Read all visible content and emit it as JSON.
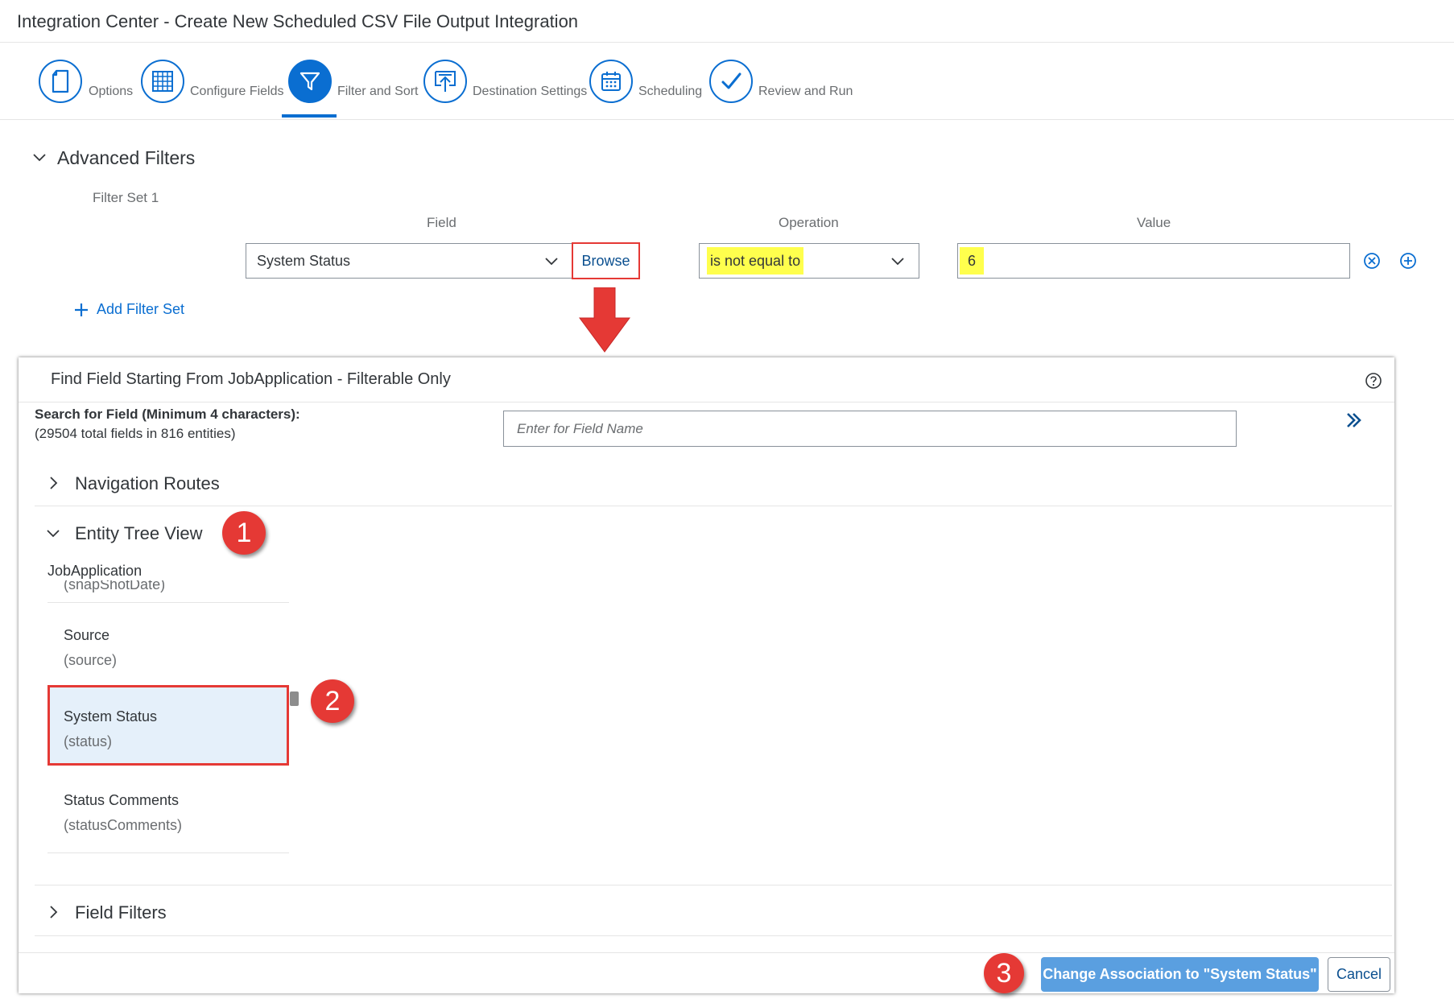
{
  "header": {
    "title": "Integration Center - Create New Scheduled CSV File Output Integration"
  },
  "wizard": {
    "steps": [
      {
        "label": "Options",
        "icon": "document-icon",
        "active": false
      },
      {
        "label": "Configure Fields",
        "icon": "table-grid-icon",
        "active": false
      },
      {
        "label": "Filter and Sort",
        "icon": "filter-icon",
        "active": true
      },
      {
        "label": "Destination Settings",
        "icon": "upload-icon",
        "active": false
      },
      {
        "label": "Scheduling",
        "icon": "calendar-icon",
        "active": false
      },
      {
        "label": "Review and Run",
        "icon": "checkmark-icon",
        "active": false
      }
    ]
  },
  "advanced_filters": {
    "title": "Advanced Filters",
    "filter_set_label": "Filter Set 1",
    "columns": {
      "field": "Field",
      "operation": "Operation",
      "value": "Value"
    },
    "row": {
      "field_value": "System Status",
      "browse_label": "Browse",
      "operation_value": "is not equal to",
      "value": "6"
    },
    "add_filter_set_label": "Add Filter Set"
  },
  "dialog": {
    "title": "Find Field Starting From JobApplication - Filterable Only",
    "search_label": "Search for Field (Minimum 4 characters):",
    "search_stats": "(29504 total fields in 816 entities)",
    "search_placeholder": "Enter for Field Name",
    "sections": {
      "navigation_routes": "Navigation Routes",
      "entity_tree_view": "Entity Tree View",
      "field_filters": "Field Filters"
    },
    "tree_root": "JobApplication",
    "tree_items": [
      {
        "name": "",
        "id": "(snapShotDate)"
      },
      {
        "name": "Source",
        "id": "(source)"
      },
      {
        "name": "System Status",
        "id": "(status)",
        "selected": true
      },
      {
        "name": "Status Comments",
        "id": "(statusComments)"
      }
    ],
    "primary_button": "Change Association to \"System Status\"",
    "cancel_button": "Cancel"
  },
  "annotations": {
    "badge1": "1",
    "badge2": "2",
    "badge3": "3"
  },
  "colors": {
    "accent": "#0a6ed1",
    "highlight": "#ffff4d",
    "callout_red": "#e53935",
    "selected_bg": "#e5f0fa"
  }
}
